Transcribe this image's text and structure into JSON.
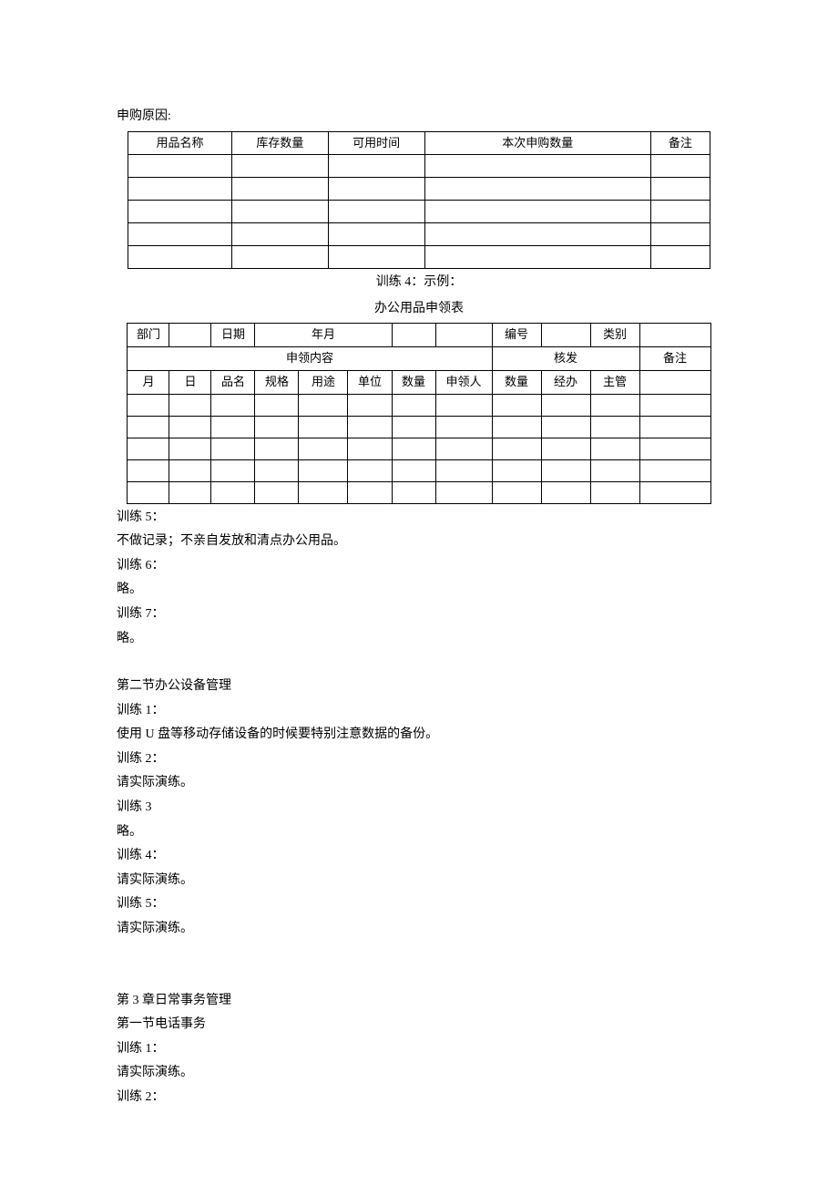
{
  "intro": {
    "reason_label": "申购原因:"
  },
  "table1": {
    "headers": [
      "用品名称",
      "库存数量",
      "可用时间",
      "本次申购数量",
      "备注"
    ]
  },
  "caption1": "训练 4：示例：",
  "caption2": "办公用品申领表",
  "table2": {
    "row1": {
      "dept_label": "部门",
      "date_label": "日期",
      "ym_label": "年月",
      "bianhao_label": "编号",
      "leibei_label": "类别"
    },
    "row2": {
      "shenling": "申领内容",
      "hefa": "核发",
      "beizhu": "备注"
    },
    "row3": {
      "yue": "月",
      "ri": "日",
      "pinming": "品名",
      "guige": "规格",
      "yongtu": "用途",
      "danwei": "单位",
      "shuliang": "数量",
      "shenlingren": "申领人",
      "shuliang2": "数量",
      "jingban": "经办",
      "zhuguan": "主管"
    }
  },
  "body": {
    "p0": "训练 5：",
    "p1": "不做记录；不亲自发放和清点办公用品。",
    "p2": "训练 6：",
    "p3": "略。",
    "p4": "训练 7：",
    "p5": "略。",
    "p6": "第二节办公设备管理",
    "p7": "训练 1：",
    "p8": "使用 U 盘等移动存储设备的时候要特别注意数据的备份。",
    "p9": "训练 2：",
    "p10": "请实际演练。",
    "p11": "训练 3",
    "p12": "略。",
    "p13": "训练 4：",
    "p14": "请实际演练。",
    "p15": "训练 5：",
    "p16": "请实际演练。",
    "p17": "第 3 章日常事务管理",
    "p18": "第一节电话事务",
    "p19": "训练 1：",
    "p20": "请实际演练。",
    "p21": "训练 2："
  }
}
